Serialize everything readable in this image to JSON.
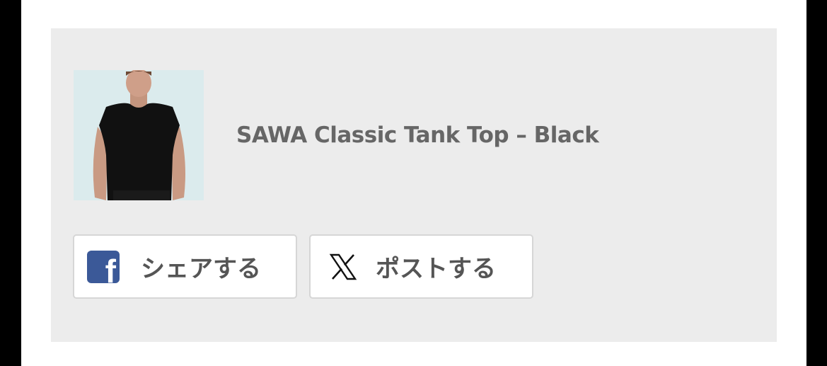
{
  "product": {
    "title": "SAWA Classic Tank Top – Black",
    "image": "model-wearing-black-tank-top"
  },
  "share": {
    "facebook_label": "シェアする",
    "facebook_icon": "facebook-icon",
    "x_label": "ポストする",
    "x_icon": "x-logo-icon"
  },
  "colors": {
    "facebook_blue": "#3b5998",
    "card_bg": "#ececec",
    "title_text": "#666666"
  }
}
